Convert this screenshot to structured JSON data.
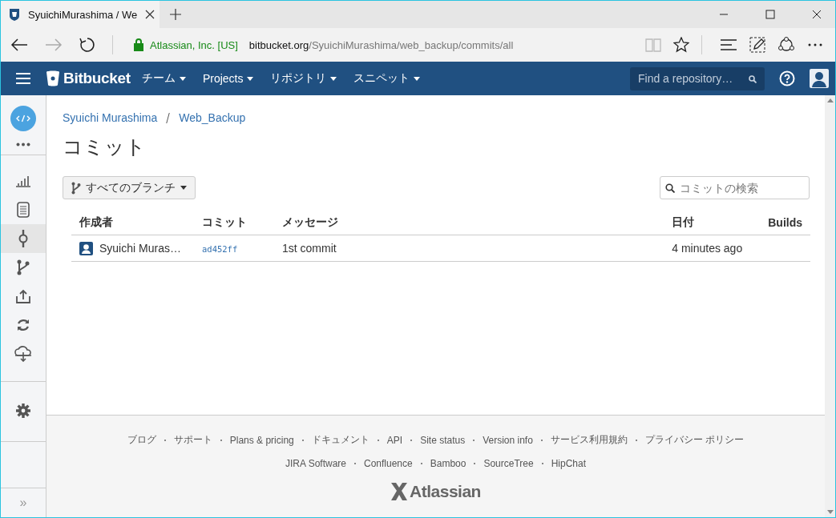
{
  "browser": {
    "tab_title": "SyuichiMurashima / We",
    "org": "Atlassian, Inc. [US]",
    "url_host": "bitbucket.org",
    "url_path": "/SyuichiMurashima/web_backup/commits/all"
  },
  "header": {
    "logo": "Bitbucket",
    "nav": [
      {
        "label": "チーム"
      },
      {
        "label": "Projects"
      },
      {
        "label": "リポジトリ"
      },
      {
        "label": "スニペット"
      }
    ],
    "search": {
      "placeholder": "Find a repository…"
    }
  },
  "sidebar": {
    "top": [
      {
        "selected": false
      },
      {
        "selected": false
      }
    ],
    "items": [
      {
        "selected": false
      },
      {
        "selected": false
      },
      {
        "selected": true
      },
      {
        "selected": false
      },
      {
        "selected": false
      },
      {
        "selected": false
      },
      {
        "selected": false
      }
    ],
    "bottom": [
      {
        "selected": false
      }
    ],
    "collapse": "»"
  },
  "breadcrumb": [
    "Syuichi Murashima",
    "Web_Backup"
  ],
  "title": "コミット",
  "branch_button": "すべてのブランチ",
  "search": {
    "placeholder": "コミットの検索"
  },
  "table": {
    "columns": [
      "作成者",
      "コミット",
      "メッセージ",
      "日付",
      "Builds"
    ],
    "rows": [
      {
        "author": "Syuichi Muras…",
        "commit": "ad452ff",
        "message": "1st commit",
        "date": "4 minutes ago"
      }
    ]
  },
  "footer": {
    "links": [
      [
        "ブログ",
        "サポート",
        "Plans & pricing",
        "ドキュメント",
        "API",
        "Site status",
        "Version info",
        "サービス利用規約",
        "プライバシー ポリシー"
      ],
      [
        "JIRA Software",
        "Confluence",
        "Bamboo",
        "SourceTree",
        "HipChat"
      ]
    ],
    "logo": "Atlassian"
  }
}
